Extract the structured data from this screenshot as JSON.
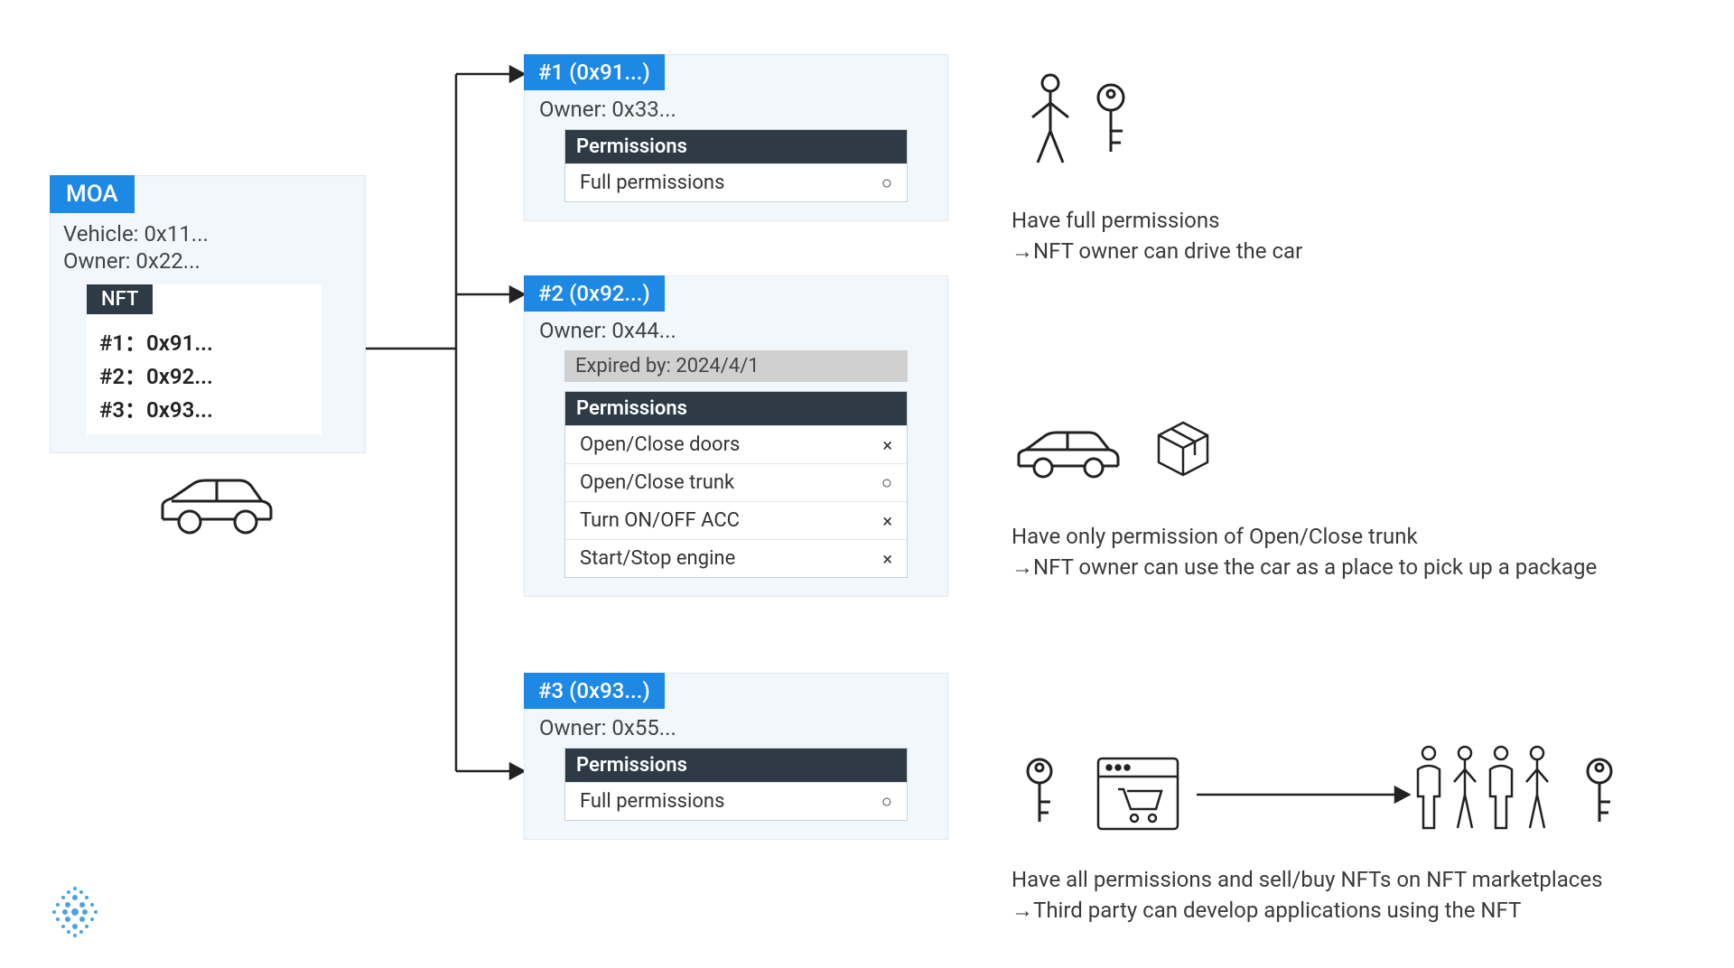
{
  "moa": {
    "tag": "MOA",
    "vehicle": "Vehicle: 0x11...",
    "owner": "Owner: 0x22...",
    "nft_label": "NFT",
    "items": [
      "#1：0x91...",
      "#2：0x92...",
      "#3：0x93..."
    ]
  },
  "cards": [
    {
      "header": "#1 (0x91...)",
      "owner": "Owner: 0x33...",
      "perm_header": "Permissions",
      "perms": [
        {
          "label": "Full permissions",
          "mark": "○"
        }
      ]
    },
    {
      "header": "#2 (0x92...)",
      "owner": "Owner: 0x44...",
      "expire": "Expired by: 2024/4/1",
      "perm_header": "Permissions",
      "perms": [
        {
          "label": "Open/Close doors",
          "mark": "×"
        },
        {
          "label": "Open/Close trunk",
          "mark": "○"
        },
        {
          "label": "Turn ON/OFF ACC",
          "mark": "×"
        },
        {
          "label": "Start/Stop engine",
          "mark": "×"
        }
      ]
    },
    {
      "header": "#3 (0x93...)",
      "owner": "Owner: 0x55...",
      "perm_header": "Permissions",
      "perms": [
        {
          "label": "Full permissions",
          "mark": "○"
        }
      ]
    }
  ],
  "explain": {
    "one_l1": "Have full permissions",
    "one_l2": "→NFT owner can drive the car",
    "two_l1": "Have only permission of Open/Close trunk",
    "two_l2": "→NFT owner can use the car as a place to pick up a package",
    "three_l1": "Have all permissions and sell/buy NFTs on NFT marketplaces",
    "three_l2": "→Third party can develop applications using the NFT"
  }
}
